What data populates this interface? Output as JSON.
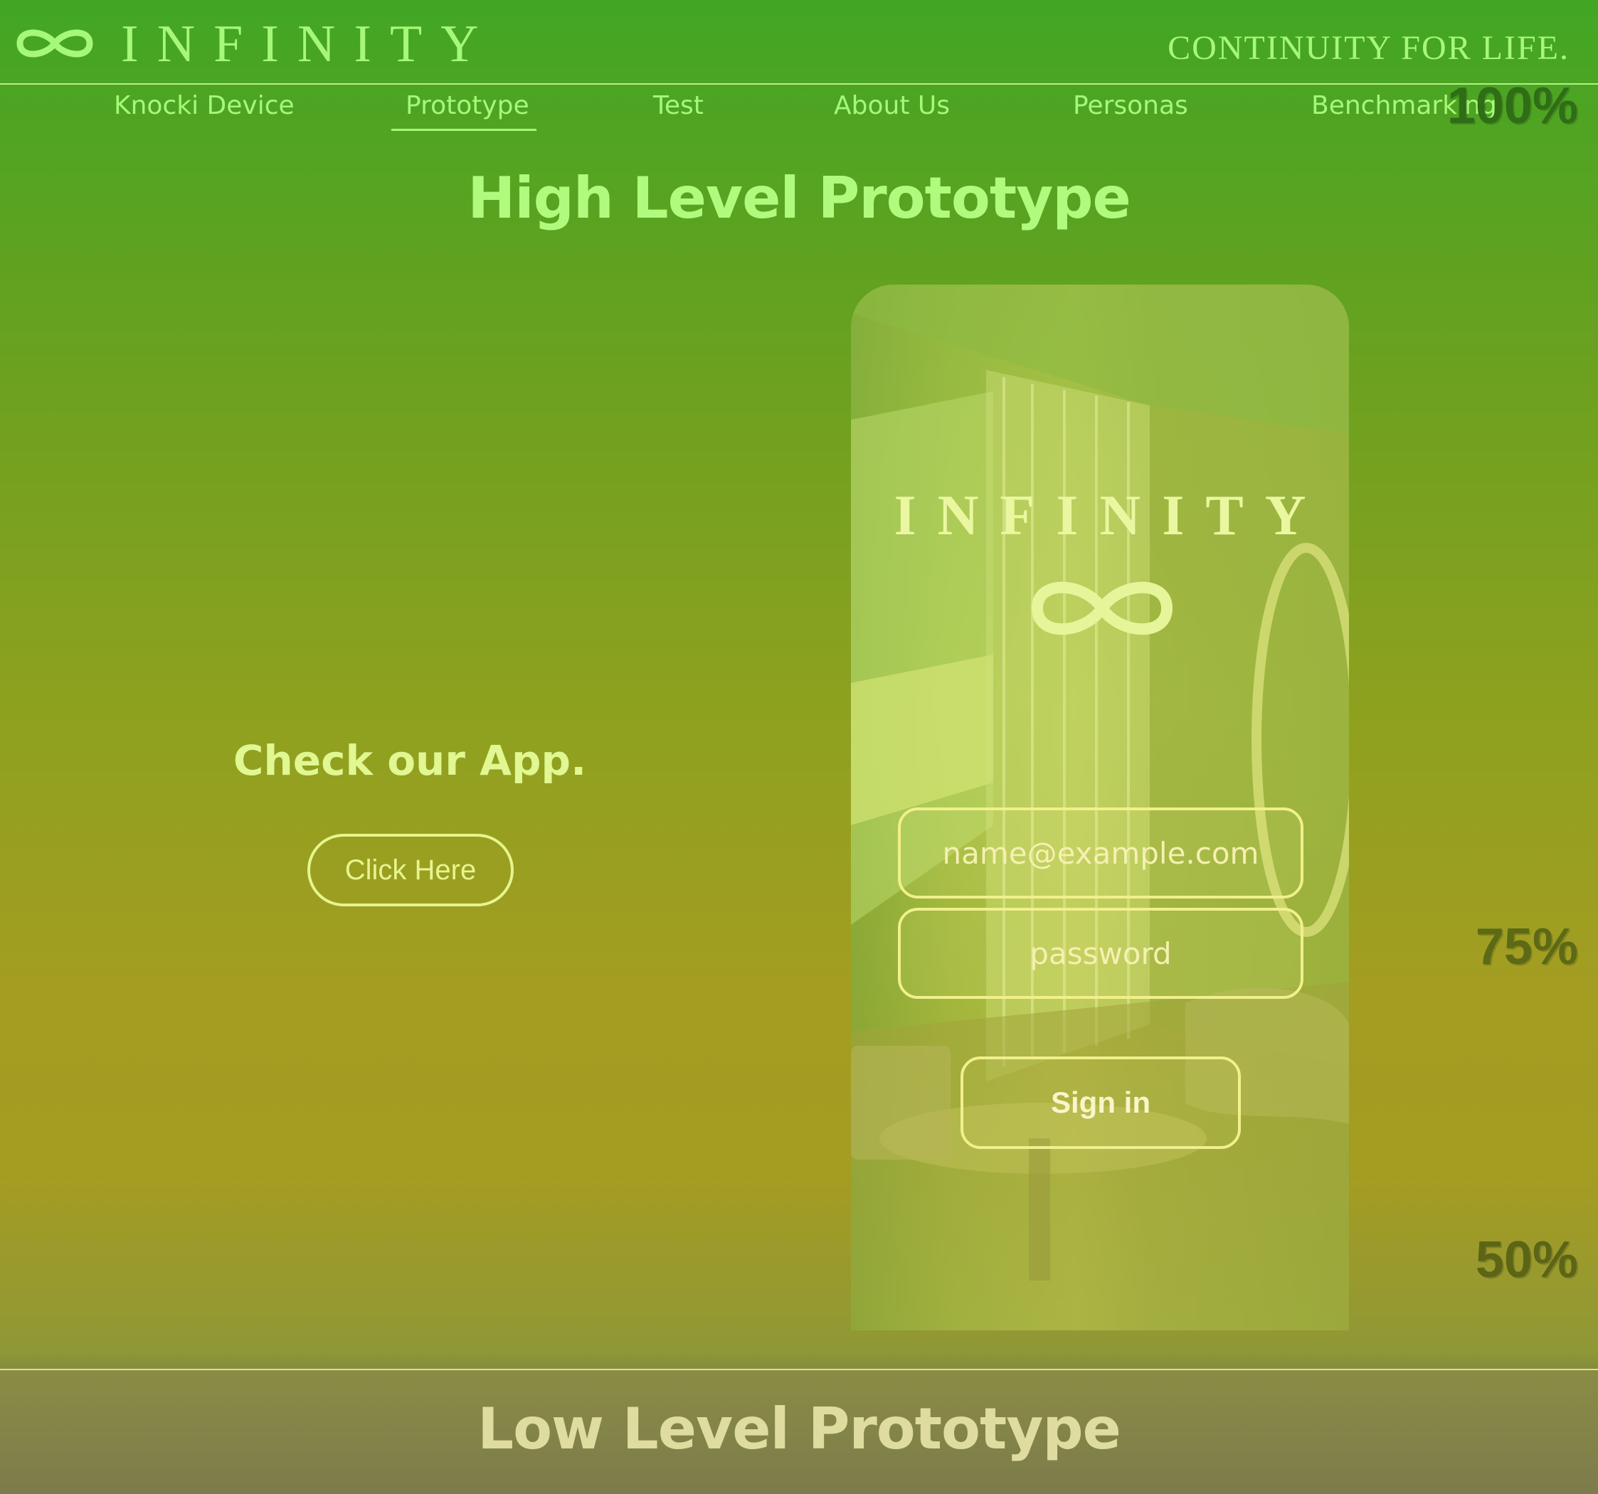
{
  "header": {
    "brand": "INFINITY",
    "tagline": "CONTINUITY FOR LIFE."
  },
  "nav": {
    "items": [
      {
        "label": "Knocki Device"
      },
      {
        "label": "Prototype",
        "active": true
      },
      {
        "label": "Test"
      },
      {
        "label": "About Us"
      },
      {
        "label": "Personas"
      },
      {
        "label": "Benchmarking"
      }
    ]
  },
  "main": {
    "title": "High Level Prototype",
    "cta_heading": "Check our App.",
    "cta_button": "Click Here"
  },
  "phone": {
    "brand": "INFINITY",
    "email_placeholder": "name@example.com",
    "password_placeholder": "password",
    "signin_label": "Sign in"
  },
  "overlay_labels": {
    "top": "100%",
    "middle": "75%",
    "bottom": "50%"
  },
  "footer": {
    "title": "Low Level Prototype"
  },
  "colors": {
    "accent_green": "#a6f878",
    "accent_yellow": "#e6f58e",
    "gradient_top": "#41a624",
    "gradient_bottom": "#a59c22"
  },
  "icons": {
    "logo": "infinity-icon"
  }
}
